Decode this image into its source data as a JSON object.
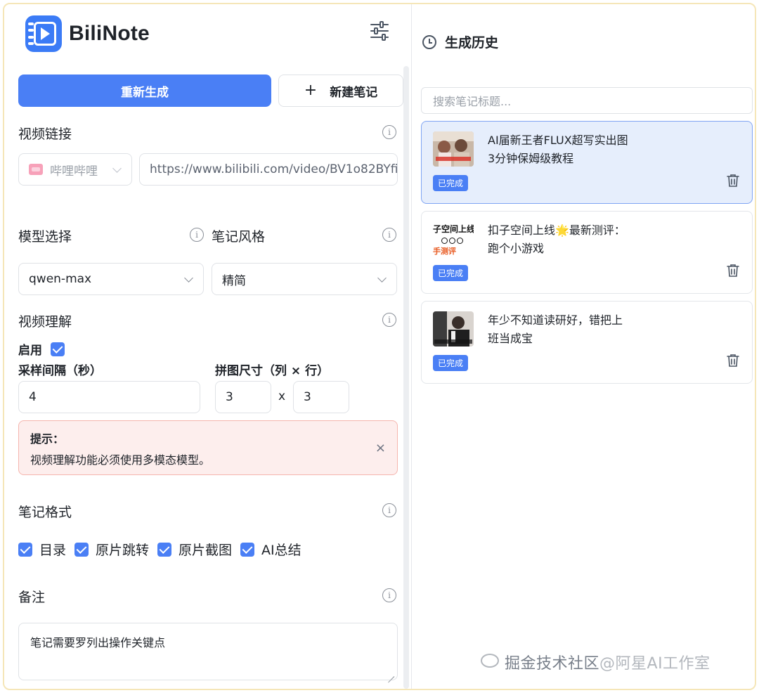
{
  "app": {
    "name": "BiliNote"
  },
  "actions": {
    "regenerate": "重新生成",
    "new_note_plus": "+",
    "new_note": "新建笔记"
  },
  "video_link": {
    "label": "视频链接",
    "platform": "哔哩哔哩",
    "url": "https://www.bilibili.com/video/BV1o82BYfi"
  },
  "model": {
    "label": "模型选择",
    "value": "qwen-max"
  },
  "style": {
    "label": "笔记风格",
    "value": "精简"
  },
  "video_understanding": {
    "label": "视频理解",
    "enable_label": "启用",
    "enabled": true,
    "interval_label": "采样间隔（秒）",
    "interval_value": "4",
    "grid_label": "拼图尺寸（列 × 行）",
    "grid_cols": "3",
    "grid_sep": "x",
    "grid_rows": "3"
  },
  "alert": {
    "title": "提示：",
    "text": "视频理解功能必须使用多模态模型。",
    "close": "×"
  },
  "note_format": {
    "label": "笔记格式",
    "options": [
      {
        "label": "目录",
        "checked": true
      },
      {
        "label": "原片跳转",
        "checked": true
      },
      {
        "label": "原片截图",
        "checked": true
      },
      {
        "label": "AI总结",
        "checked": true
      }
    ]
  },
  "remarks": {
    "label": "备注",
    "value": "笔记需要罗列出操作关键点"
  },
  "history": {
    "title": "生成历史",
    "search_placeholder": "搜索笔记标题...",
    "items": [
      {
        "title_line1": "AI届新王者FLUX超写实出图",
        "title_line2": "3分钟保姆级教程",
        "status": "已完成",
        "active": true
      },
      {
        "title_line1": "扣子空间上线🌟最新测评：",
        "title_line2": "跑个小游戏",
        "status": "已完成",
        "active": false,
        "thumb_text_1": "子空间上线",
        "thumb_text_2": "手测评"
      },
      {
        "title_line1": "年少不知道读研好，错把上",
        "title_line2": "班当成宝",
        "status": "已完成",
        "active": false
      }
    ]
  },
  "watermark": {
    "text1": "掘金技术社区",
    "text2": "@阿星AI工作室"
  },
  "colors": {
    "primary": "#4a7ff5",
    "alert_bg": "#fdeeed",
    "active_card": "#e6eefc"
  }
}
